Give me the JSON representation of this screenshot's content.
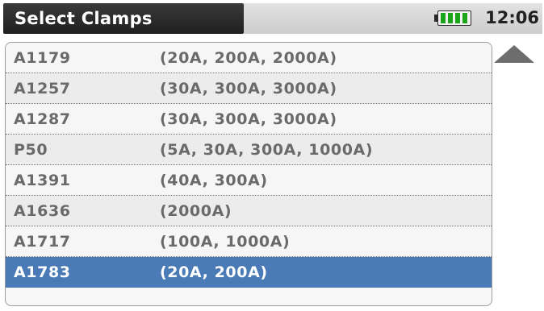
{
  "header": {
    "title": "Select Clamps",
    "time": "12:06",
    "battery_level": 4,
    "battery_color": "#1aa41a"
  },
  "list": {
    "items": [
      {
        "model": "A1179",
        "ranges": "(20A, 200A, 2000A)"
      },
      {
        "model": "A1257",
        "ranges": "(30A, 300A, 3000A)"
      },
      {
        "model": "A1287",
        "ranges": "(30A, 300A, 3000A)"
      },
      {
        "model": "P50",
        "ranges": "(5A, 30A, 300A, 1000A)"
      },
      {
        "model": "A1391",
        "ranges": "(40A, 300A)"
      },
      {
        "model": "A1636",
        "ranges": "(2000A)"
      },
      {
        "model": "A1717",
        "ranges": "(100A, 1000A)"
      },
      {
        "model": "A1783",
        "ranges": "(20A, 200A)"
      }
    ],
    "selected_index": 7,
    "selected_color": "#4a7bb6"
  },
  "scrollbar": {
    "up_icon": "triangle-up-icon"
  }
}
